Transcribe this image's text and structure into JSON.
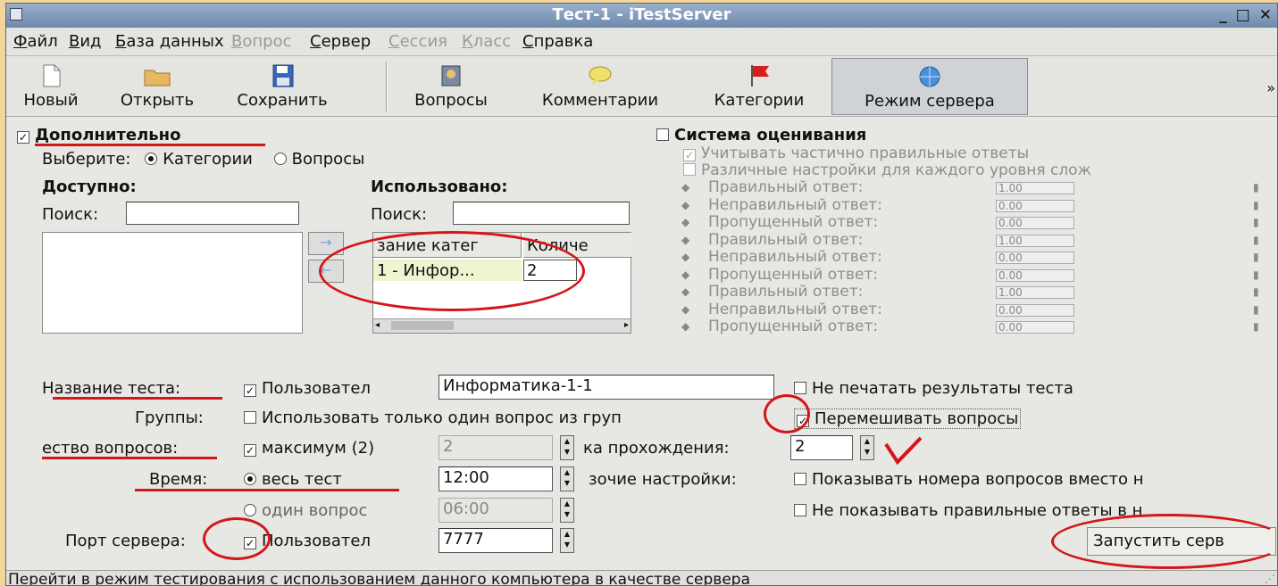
{
  "window": {
    "title": "Тест-1 - iTestServer",
    "controls": "_ □ ✕"
  },
  "menu": [
    {
      "label": "Файл",
      "enabled": true
    },
    {
      "label": "Вид",
      "enabled": true
    },
    {
      "label": "База данных",
      "enabled": true
    },
    {
      "label": "Вопрос",
      "enabled": false
    },
    {
      "label": "Сервер",
      "enabled": true
    },
    {
      "label": "Сессия",
      "enabled": false
    },
    {
      "label": "Класс",
      "enabled": false
    },
    {
      "label": "Справка",
      "enabled": true
    }
  ],
  "toolbar": {
    "new": "Новый",
    "open": "Открыть",
    "save": "Сохранить",
    "questions": "Вопросы",
    "comments": "Комментарии",
    "categories": "Категории",
    "server_mode": "Режим сервера",
    "more": "»"
  },
  "advanced": {
    "title": "Дополнительно",
    "select_label": "Выберите:",
    "opt_categories": "Категории",
    "opt_questions": "Вопросы",
    "available": "Доступно:",
    "used": "Использовано:",
    "search_label": "Поиск:",
    "search_label2": "Поиск:",
    "col_name": "зание катег",
    "col_count": "Количе",
    "row_name": "1 - Инфор...",
    "row_count": "2"
  },
  "grading": {
    "title": "Система оценивания",
    "partial": "Учитывать частично правильные ответы",
    "per_level": "Различные настройки для каждого уровня слож",
    "rows": [
      {
        "label": "Правильный ответ:",
        "value": "1.00"
      },
      {
        "label": "Неправильный ответ:",
        "value": "0.00"
      },
      {
        "label": "Пропущенный ответ:",
        "value": "0.00"
      },
      {
        "label": "Правильный ответ:",
        "value": "1.00"
      },
      {
        "label": "Неправильный ответ:",
        "value": "0.00"
      },
      {
        "label": "Пропущенный ответ:",
        "value": "0.00"
      },
      {
        "label": "Правильный ответ:",
        "value": "1.00"
      },
      {
        "label": "Неправильный ответ:",
        "value": "0.00"
      },
      {
        "label": "Пропущенный ответ:",
        "value": "0.00"
      }
    ]
  },
  "settings": {
    "test_name_label": "Название теста:",
    "test_name_check": "Пользовател",
    "test_name_value": "Информатика-1-1",
    "no_print": "Не печатать результаты теста",
    "groups_label": "Группы:",
    "groups_check": "Использовать только один вопрос из груп",
    "shuffle": "Перемешивать вопросы",
    "qcount_label": "ество вопросов:",
    "qcount_check": "максимум (2)",
    "qcount_value": "2",
    "attempts_label": "ка прохождения:",
    "attempts_value": "2",
    "time_label": "Время:",
    "time_whole": "весь тест",
    "time_whole_value": "12:00",
    "other_label": "зочие настройки:",
    "show_numbers": "Показывать номера вопросов вместо н",
    "time_one": "один вопрос",
    "time_one_value": "06:00",
    "no_correct": "Не показывать правильные ответы в н",
    "port_label": "Порт сервера:",
    "port_check": "Пользовател",
    "port_value": "7777",
    "start_button": "Запустить серв"
  },
  "status": "Перейти в режим тестирования с использованием данного компьютера в качестве сервера"
}
